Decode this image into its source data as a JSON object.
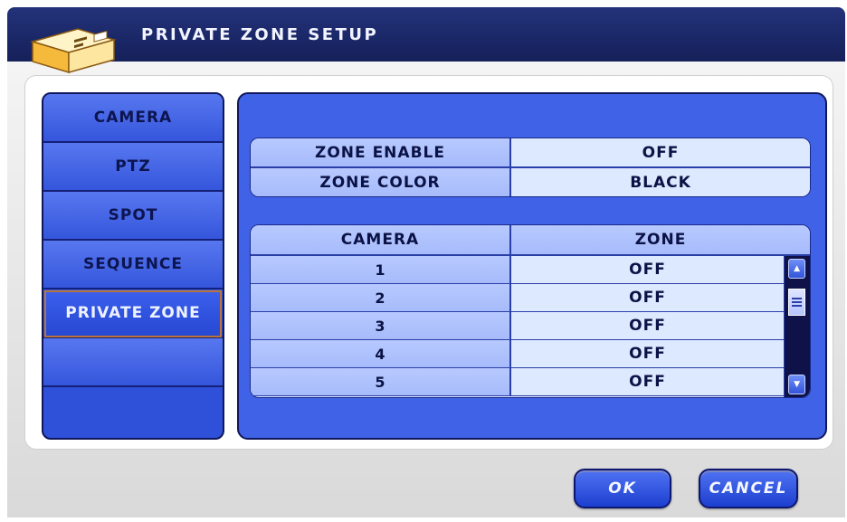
{
  "window": {
    "title": "PRIVATE ZONE SETUP",
    "icon": "dvr-device-icon"
  },
  "sidebar": {
    "items": [
      {
        "label": "CAMERA",
        "active": false
      },
      {
        "label": "PTZ",
        "active": false
      },
      {
        "label": "SPOT",
        "active": false
      },
      {
        "label": "SEQUENCE",
        "active": false
      },
      {
        "label": "PRIVATE ZONE",
        "active": true
      }
    ]
  },
  "settings": {
    "zone_enable": {
      "label": "ZONE ENABLE",
      "value": "OFF"
    },
    "zone_color": {
      "label": "ZONE COLOR",
      "value": "BLACK"
    }
  },
  "zone_table": {
    "headers": {
      "camera": "CAMERA",
      "zone": "ZONE"
    },
    "rows": [
      {
        "camera": "1",
        "zone": "OFF"
      },
      {
        "camera": "2",
        "zone": "OFF"
      },
      {
        "camera": "3",
        "zone": "OFF"
      },
      {
        "camera": "4",
        "zone": "OFF"
      },
      {
        "camera": "5",
        "zone": "OFF"
      }
    ]
  },
  "buttons": {
    "ok": "OK",
    "cancel": "CANCEL"
  },
  "colors": {
    "header": "#1b2868",
    "panel": "#3f62e6",
    "accent_border": "#b8743a"
  }
}
